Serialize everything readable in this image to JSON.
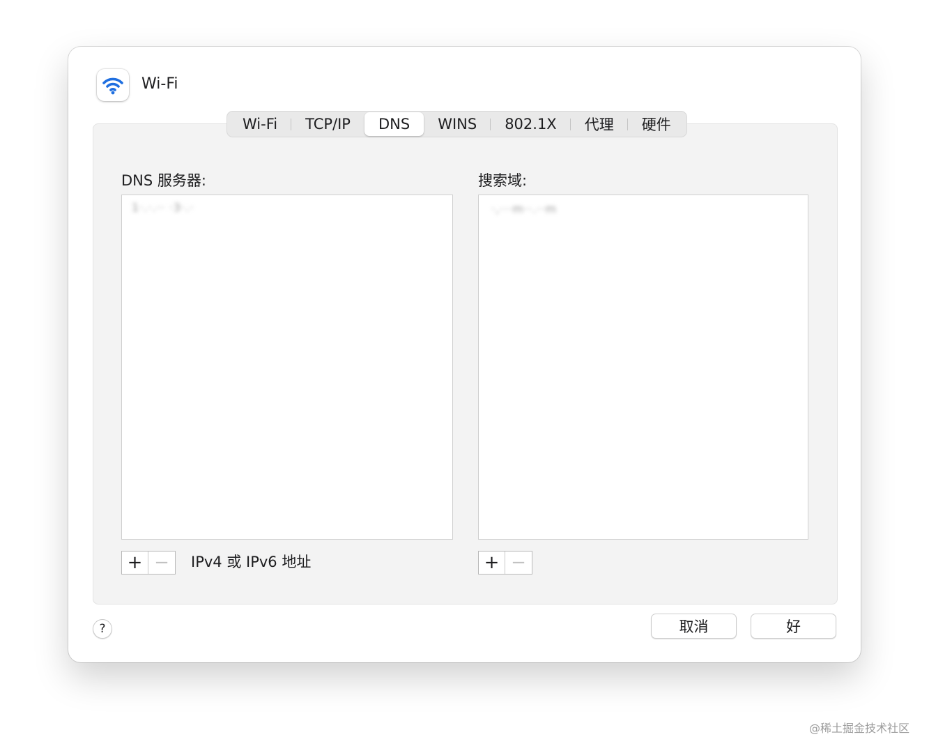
{
  "window": {
    "title": "Wi-Fi",
    "app_icon": "wifi-icon",
    "accent_color": "#1f6fe0"
  },
  "tabs": [
    {
      "label": "Wi-Fi",
      "active": false
    },
    {
      "label": "TCP/IP",
      "active": false
    },
    {
      "label": "DNS",
      "active": true
    },
    {
      "label": "WINS",
      "active": false
    },
    {
      "label": "802.1X",
      "active": false
    },
    {
      "label": "代理",
      "active": false
    },
    {
      "label": "硬件",
      "active": false
    }
  ],
  "dns": {
    "servers_label": "DNS 服务器:",
    "servers": [
      "1·.·.·· ·3·.·"
    ],
    "search_label": "搜索域:",
    "search_domains": [
      "·,···m··.··m"
    ],
    "add_symbol": "+",
    "remove_symbol": "−",
    "hint": "IPv4 或 IPv6 地址"
  },
  "footer": {
    "help_symbol": "?",
    "cancel_label": "取消",
    "ok_label": "好"
  },
  "watermark": "@稀土掘金技术社区"
}
